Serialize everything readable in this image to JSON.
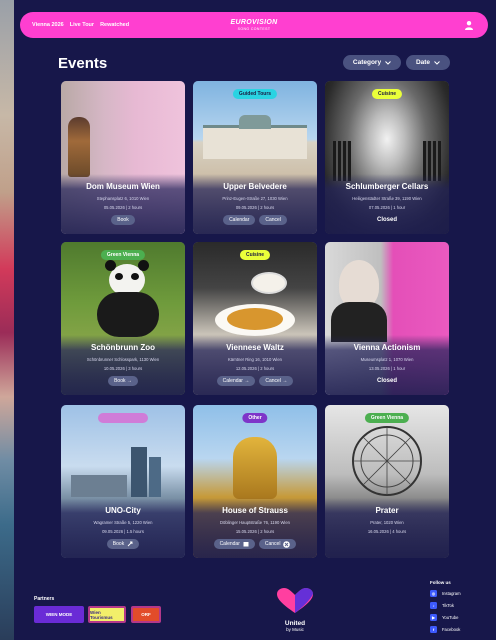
{
  "nav": {
    "links": [
      "Vienna 2026",
      "Live Tour",
      "Rewatched"
    ],
    "logo_line1": "EUROVISION",
    "logo_line2": "SONG CONTEST"
  },
  "page": {
    "title": "Events",
    "filters": {
      "category": "Category",
      "date": "Date"
    }
  },
  "events": [
    {
      "name": "Dom Museum Wien",
      "address": "Stephansplatz 6, 1010 Wien",
      "datetime": "05.05.2026 | 2 hours",
      "buttons": [
        "Book"
      ]
    },
    {
      "name": "Upper Belvedere",
      "tag": "Guided Tours",
      "address": "Prinz-Eugen-Straße 27, 1030 Wien",
      "datetime": "09.05.2026 | 2 hours",
      "buttons": [
        "Calendar",
        "Cancel"
      ]
    },
    {
      "name": "Schlumberger Cellars",
      "tag": "Cuisine",
      "address": "Heiligenstädter Straße 39, 1190 Wien",
      "datetime": "07.05.2026 | 1 hour",
      "status": "Closed"
    },
    {
      "name": "Schönbrunn Zoo",
      "tag": "Green Vienna",
      "address": "Schönbrunner Schlosspark, 1130 Wien",
      "datetime": "10.05.2026 | 3 hours",
      "buttons": [
        "Book →"
      ]
    },
    {
      "name": "Viennese Waltz",
      "tag": "Cuisine",
      "address": "Kärntner Ring 16, 1010 Wien",
      "datetime": "12.05.2026 | 2 hours",
      "buttons": [
        "Calendar →",
        "Cancel →"
      ]
    },
    {
      "name": "Vienna Actionism",
      "address": "Museumsplatz 1, 1070 Wien",
      "datetime": "13.05.2026 | 1 hour",
      "status": "Closed"
    },
    {
      "name": "UNO-City",
      "tag": "",
      "address": "Wagramer Straße 5, 1220 Wien",
      "datetime": "09.05.2026 | 1.5 hours",
      "buttons": [
        "Book"
      ]
    },
    {
      "name": "House of Strauss",
      "tag": "Other",
      "address": "Döblinger Hauptstraße 76, 1190 Wien",
      "datetime": "15.05.2026 | 2 hours",
      "buttons": [
        "Calendar",
        "Cancel"
      ]
    },
    {
      "name": "Prater",
      "tag": "Green Vienna",
      "address": "Prater, 1020 Wien",
      "datetime": "16.05.2026 | 4 hours"
    }
  ],
  "footer": {
    "partners_label": "Partners",
    "partners": [
      "WIEN MODE",
      "Wien Tourismus",
      "ORF"
    ],
    "brand_line1": "United",
    "brand_line2": "by Music",
    "follow_label": "Follow us",
    "social": [
      "Instagram",
      "TikTok",
      "YouTube",
      "Facebook"
    ]
  },
  "colors": {
    "background": "#17174a",
    "navbar": "#ff3fd0",
    "tag_guided": "#29d3e2",
    "tag_cuisine": "#eaff3a",
    "tag_green": "#4caf50",
    "tag_pink": "#d07cd8",
    "tag_other": "#7e35c9"
  },
  "icons": [
    "user-icon",
    "chevron-down-icon",
    "calendar-icon",
    "close-icon",
    "arrow-right-icon",
    "instagram-icon",
    "tiktok-icon",
    "youtube-icon",
    "facebook-icon",
    "heart-logo"
  ]
}
